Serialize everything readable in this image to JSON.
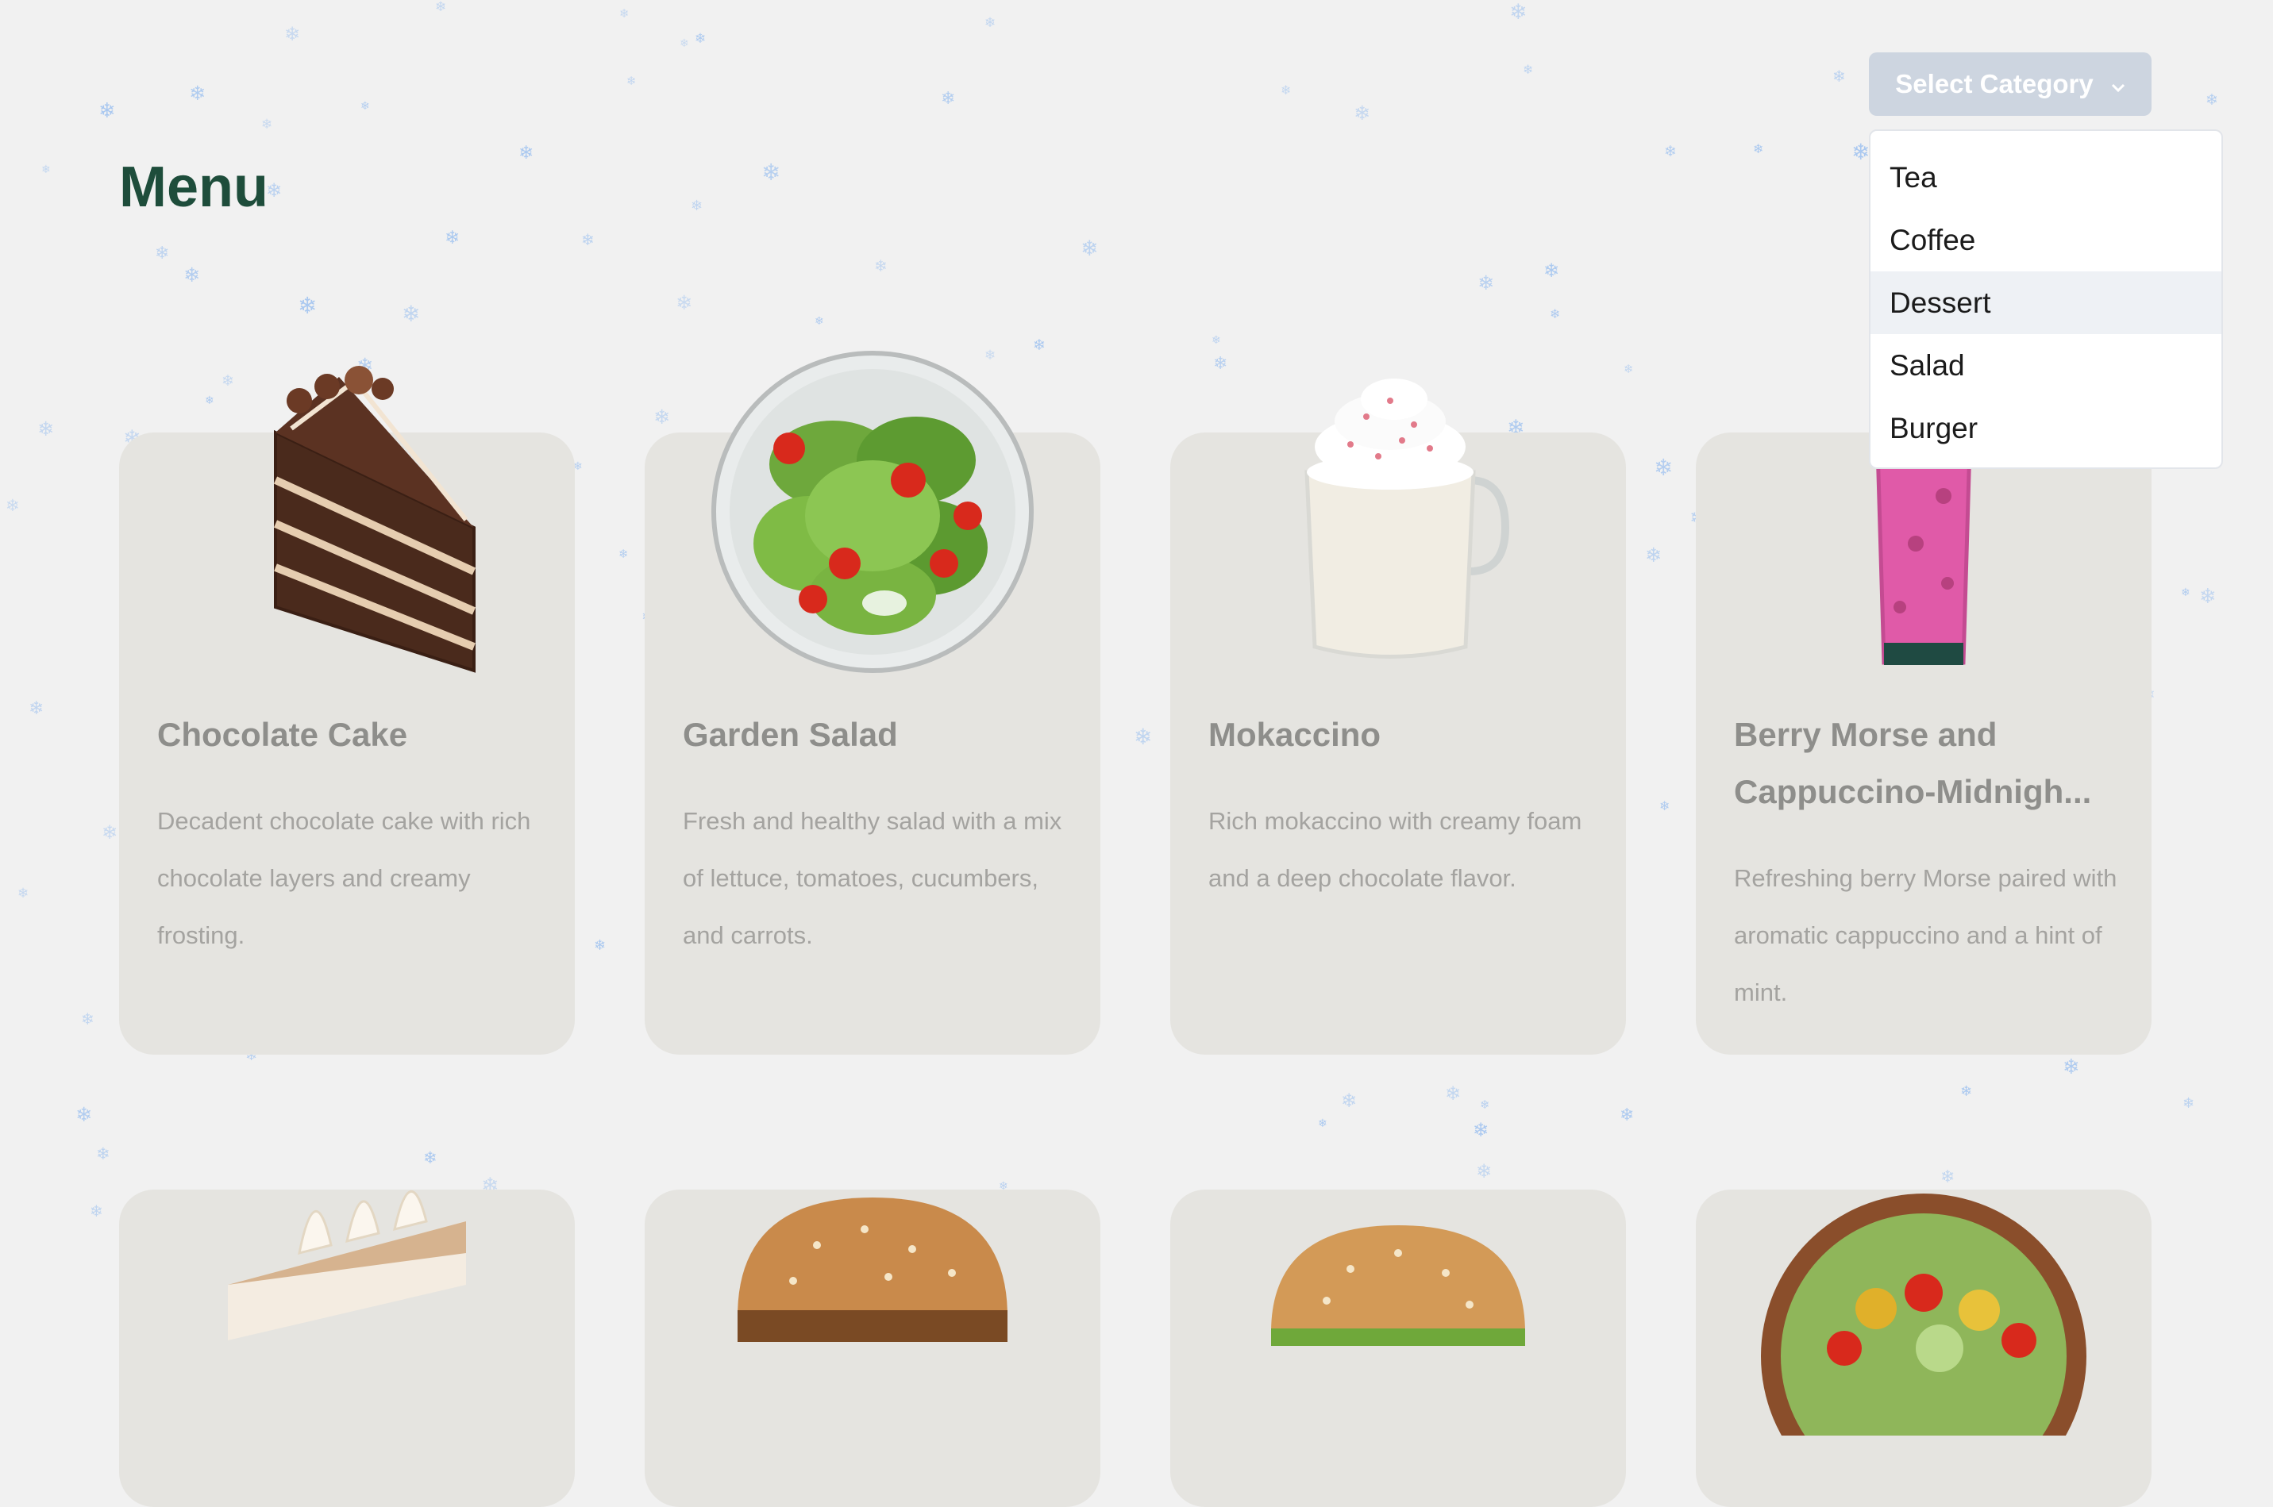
{
  "page": {
    "title": "Menu"
  },
  "category_select": {
    "label": "Select Category",
    "options": [
      "Tea",
      "Coffee",
      "Dessert",
      "Salad",
      "Burger"
    ],
    "hovered": "Dessert"
  },
  "menu_items": [
    {
      "name": "Chocolate Cake",
      "description": "Decadent chocolate cake with rich chocolate layers and creamy frosting.",
      "image": "chocolate-cake-image"
    },
    {
      "name": "Garden Salad",
      "description": "Fresh and healthy salad with a mix of lettuce, tomatoes, cucumbers, and carrots.",
      "image": "garden-salad-image"
    },
    {
      "name": "Mokaccino",
      "description": "Rich mokaccino with creamy foam and a deep chocolate flavor.",
      "image": "mokaccino-image"
    },
    {
      "name": "Berry Morse and Cappuccino-Midnigh...",
      "description": "Refreshing berry Morse paired with aromatic cappuccino and a hint of mint.",
      "image": "berry-drink-image"
    }
  ],
  "colors": {
    "title": "#1e4d3b",
    "card_background": "#e5e4e0",
    "select_button": "#cdd5e0",
    "snowflake": "#a9c8f0"
  }
}
